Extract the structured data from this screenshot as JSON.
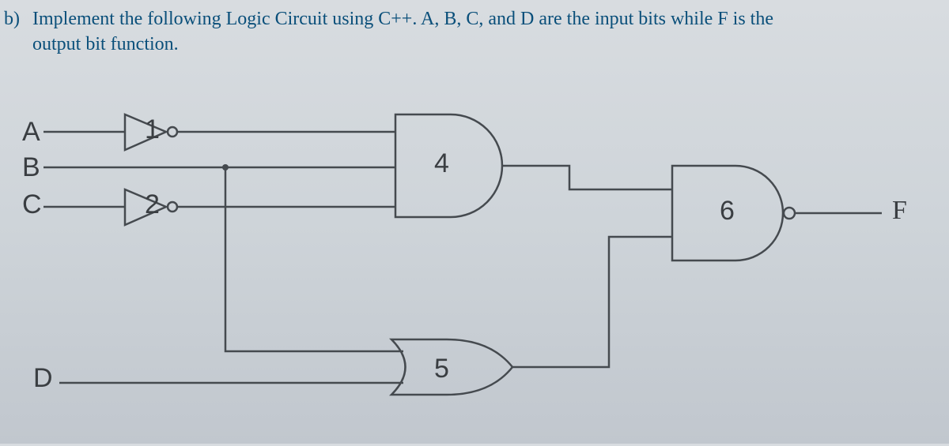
{
  "question": {
    "label": "b)",
    "text_line1": "Implement the following Logic Circuit using C++. A, B, C, and D are the input bits while F is the",
    "text_line2": "output bit function."
  },
  "inputs": {
    "A": "A",
    "B": "B",
    "C": "C",
    "D": "D"
  },
  "gates": {
    "g1": "1",
    "g2": "2",
    "g4": "4",
    "g5": "5",
    "g6": "6"
  },
  "output": {
    "F": "F"
  },
  "chart_data": {
    "type": "logic_circuit",
    "inputs": [
      "A",
      "B",
      "C",
      "D"
    ],
    "output": "F",
    "gates": [
      {
        "id": 1,
        "type": "NOT",
        "inputs": [
          "A"
        ],
        "output": "A_not"
      },
      {
        "id": 2,
        "type": "NOT",
        "inputs": [
          "C"
        ],
        "output": "C_not"
      },
      {
        "id": 4,
        "type": "AND",
        "inputs": [
          "A_not",
          "B",
          "C_not"
        ],
        "output": "G4"
      },
      {
        "id": 5,
        "type": "OR",
        "inputs": [
          "B",
          "D"
        ],
        "output": "G5"
      },
      {
        "id": 6,
        "type": "NAND",
        "inputs": [
          "G4",
          "G5"
        ],
        "output": "F"
      }
    ],
    "expression": "F = NOT( (NOT A AND B AND NOT C) AND (B OR D) )"
  }
}
